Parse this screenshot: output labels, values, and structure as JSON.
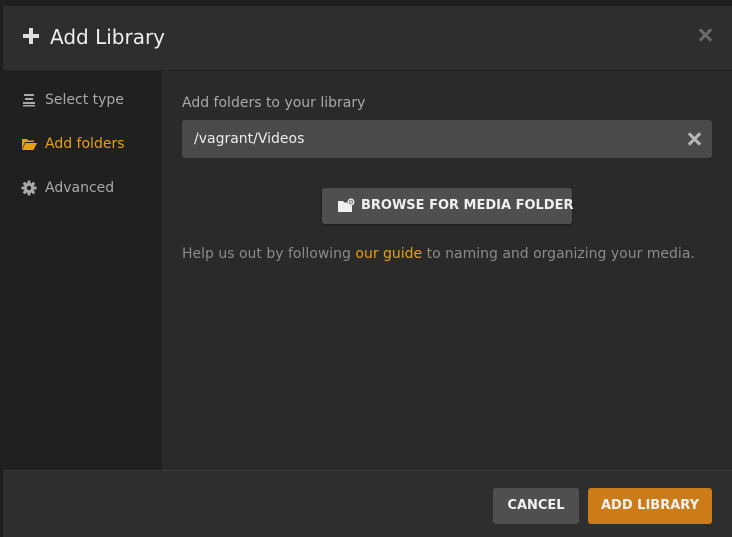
{
  "header": {
    "title": "Add Library"
  },
  "sidebar": {
    "items": [
      {
        "label": "Select type",
        "icon": "list-icon"
      },
      {
        "label": "Add folders",
        "icon": "folder-open-icon",
        "active": true
      },
      {
        "label": "Advanced",
        "icon": "gear-icon"
      }
    ]
  },
  "content": {
    "field_label": "Add folders to your library",
    "folder_value": "/vagrant/Videos",
    "browse_label": "BROWSE FOR MEDIA FOLDER",
    "help_prefix": "Help us out by following ",
    "help_link": "our guide",
    "help_suffix": " to naming and organizing your media."
  },
  "footer": {
    "cancel_label": "CANCEL",
    "add_label": "ADD LIBRARY"
  },
  "colors": {
    "accent": "#e5a00d",
    "primary_button": "#cc7b19",
    "secondary_button": "#4f4f4f"
  }
}
